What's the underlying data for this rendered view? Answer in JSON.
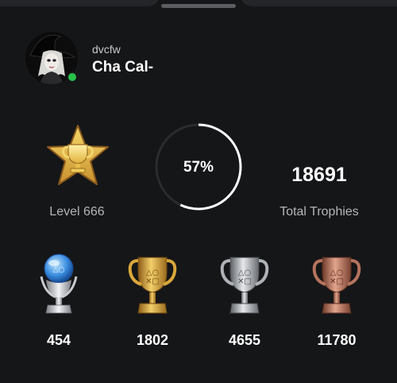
{
  "profile": {
    "online_id": "dvcfw",
    "name": "Cha Cal-",
    "status": "online"
  },
  "level": {
    "label": "Level 666",
    "icon": "gold-trophy-star-icon"
  },
  "progress": {
    "label": "57%",
    "value": 0.57
  },
  "total": {
    "value": "18691",
    "label": "Total Trophies"
  },
  "trophies": [
    {
      "type": "platinum",
      "icon": "platinum-trophy-icon",
      "count": "454"
    },
    {
      "type": "gold",
      "icon": "gold-trophy-icon",
      "count": "1802"
    },
    {
      "type": "silver",
      "icon": "silver-trophy-icon",
      "count": "4655"
    },
    {
      "type": "bronze",
      "icon": "bronze-trophy-icon",
      "count": "11780"
    }
  ],
  "colors": {
    "background": "#151618",
    "online": "#28c24a",
    "ring_track": "#2a2c2f",
    "ring_fill": "#ffffff",
    "gold": "#d9a73a",
    "silver": "#c4c6c9",
    "bronze": "#b5735c",
    "platinum": "#4aa3e8"
  }
}
